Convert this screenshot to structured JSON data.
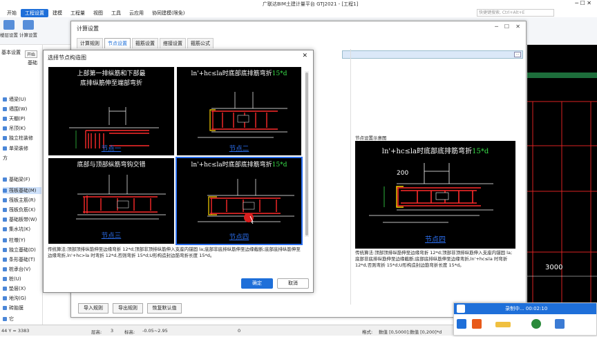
{
  "app": {
    "title": "广联达BIM土建计量平台 GTJ2021 - [工程1]"
  },
  "menu": [
    {
      "label": "开始"
    },
    {
      "label": "工程设置",
      "active": true
    },
    {
      "label": "建模"
    },
    {
      "label": "工程量"
    },
    {
      "label": "视图"
    },
    {
      "label": "工具"
    },
    {
      "label": "云应用"
    },
    {
      "label": "协同建模(限免)"
    }
  ],
  "search": {
    "placeholder": "快捷键搜索, Ctrl+Alt+E"
  },
  "ribbon": [
    {
      "label": "楼层设置"
    },
    {
      "label": "计算设置"
    }
  ],
  "left_panel": {
    "top_label": "基本设置",
    "sub_label": "开始",
    "tab_label": "基础",
    "items": [
      "墙梁(U)",
      "墙围(W)",
      "天棚(P)",
      "吊顶(K)",
      "独立柱装修",
      "单梁装修",
      "方",
      "基础梁(F)",
      "筏板基础(M)",
      "筏板主筋(R)",
      "筏板负筋(X)",
      "基础板带(W)",
      "集水坑(K)",
      "柱墩(Y)",
      "独立基础(D)",
      "条形基础(T)",
      "桩承台(V)",
      "桩(U)",
      "垫层(X)",
      "地沟(G)",
      "砖胎膜",
      "它"
    ]
  },
  "calc_window": {
    "title": "计算设置",
    "tabs": [
      "计算规则",
      "节点设置",
      "箍筋设置",
      "搭接设置",
      "箍筋公式"
    ],
    "selected_tab": 1,
    "preview_title": "节点设置示意图",
    "preview_desc": "传统算法:顶部顶排纵筋伸至边缘弯折 12*d;顶部非顶排纵筋伸入支座内锚固 la;底部非底排纵筋伸至边缘截断;底部底排纵筋伸至边缘弯折,ln'+hc≤la 时弯折 12*d,否则弯折 15*d;U形构造封边筋弯折长度 15*d。",
    "buttons": [
      "导入规则",
      "导出规则",
      "恢复默认值"
    ]
  },
  "node_dialog": {
    "title": "选择节点构造图",
    "nodes": [
      {
        "text1": "上部第一排纵筋和下部最",
        "text2": "底排纵筋伸至端部弯折",
        "caption": "节点一"
      },
      {
        "text1": "ln'+hc≤la时底部底排筋弯折",
        "green": "15*d",
        "caption": "节点二"
      },
      {
        "text1": "底部与顶部纵筋弯钩交错",
        "caption": "节点三"
      },
      {
        "text1": "ln'+hc≤la时底部底排筋弯折",
        "green": "15*d",
        "caption": "节点四"
      }
    ],
    "selected": 3,
    "desc": "传统算法:顶部顶排纵筋伸至边缘弯折 12*d;顶部非顶排纵筋伸入支座内锚固 la;底部非底排纵筋伸至边缘截断;底部底排纵筋伸至边缘弯折,ln'+hc>la 时弯折 12*d,否则弯折 15*d;U形构造封边筋弯折长度 15*d。",
    "ok": "确定",
    "cancel": "取消"
  },
  "preview": {
    "text1": "ln'+hc≤la时底部底排筋弯折",
    "green": "15*d",
    "caption": "节点四",
    "dim200": "200"
  },
  "cad": {
    "label": "3000"
  },
  "status": {
    "coords": "44 Y = 3383",
    "floor": "层高:",
    "floor_val": "3",
    "elev": "标高:",
    "elev_val": "-0.05~2.95",
    "zero": "0",
    "fmt": "格式:",
    "fmt_val": "数值 [0,5000];数值 [0,200]*d"
  },
  "recorder": {
    "title": "录制中... 00:02:10"
  },
  "colors": {
    "accent": "#1e6fd9",
    "rebar": "#ff2a2a",
    "caption": "#2b6ff0",
    "green": "#39e04a"
  }
}
